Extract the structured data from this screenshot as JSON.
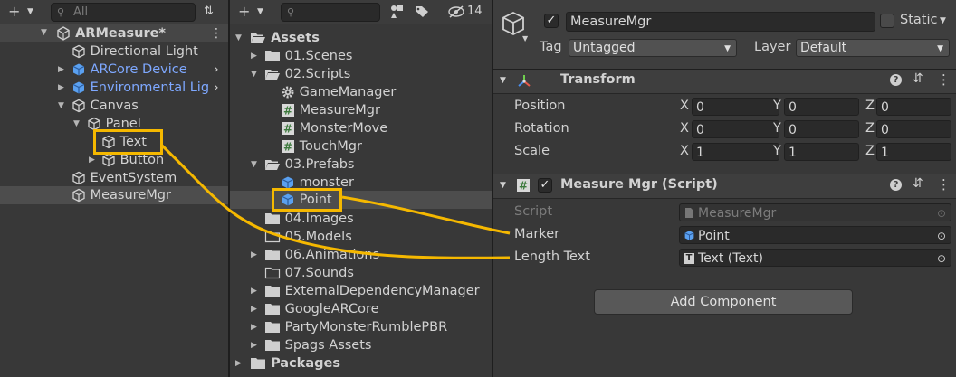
{
  "hierarchy": {
    "search_placeholder": "All",
    "scene_name": "ARMeasure*",
    "items": [
      {
        "label": "Directional Light"
      },
      {
        "label": "ARCore Device"
      },
      {
        "label": "Environmental Lig"
      },
      {
        "label": "Canvas"
      },
      {
        "label": "Panel"
      },
      {
        "label": "Text"
      },
      {
        "label": "Button"
      },
      {
        "label": "EventSystem"
      },
      {
        "label": "MeasureMgr"
      }
    ]
  },
  "project": {
    "hidden_count": "14",
    "items": [
      {
        "label": "Assets"
      },
      {
        "label": "01.Scenes"
      },
      {
        "label": "02.Scripts"
      },
      {
        "label": "GameManager"
      },
      {
        "label": "MeasureMgr"
      },
      {
        "label": "MonsterMove"
      },
      {
        "label": "TouchMgr"
      },
      {
        "label": "03.Prefabs"
      },
      {
        "label": "monster"
      },
      {
        "label": "Point"
      },
      {
        "label": "04.Images"
      },
      {
        "label": "05.Models"
      },
      {
        "label": "06.Animations"
      },
      {
        "label": "07.Sounds"
      },
      {
        "label": "ExternalDependencyManager"
      },
      {
        "label": "GoogleARCore"
      },
      {
        "label": "PartyMonsterRumblePBR"
      },
      {
        "label": "Spags Assets"
      },
      {
        "label": "Packages"
      }
    ]
  },
  "inspector": {
    "object_name": "MeasureMgr",
    "static_label": "Static",
    "tag_label": "Tag",
    "tag_value": "Untagged",
    "layer_label": "Layer",
    "layer_value": "Default",
    "transform": {
      "title": "Transform",
      "position_label": "Position",
      "rotation_label": "Rotation",
      "scale_label": "Scale",
      "x": "X",
      "y": "Y",
      "z": "Z",
      "position": [
        "0",
        "0",
        "0"
      ],
      "rotation": [
        "0",
        "0",
        "0"
      ],
      "scale": [
        "1",
        "1",
        "1"
      ]
    },
    "script_component": {
      "title": "Measure Mgr (Script)",
      "script_label": "Script",
      "script_value": "MeasureMgr",
      "marker_label": "Marker",
      "marker_value": "Point",
      "length_text_label": "Length Text",
      "length_text_value": "Text (Text)"
    },
    "add_component": "Add Component"
  },
  "colors": {
    "highlight": "#f5b800",
    "prefab_blue": "#7ea8ff",
    "panel_bg": "#383838"
  }
}
